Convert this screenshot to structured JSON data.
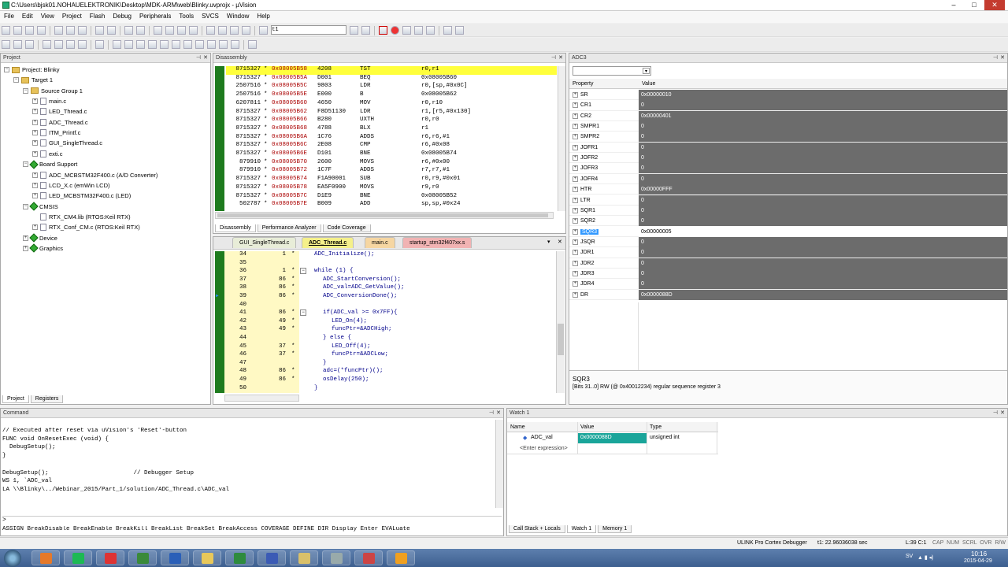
{
  "window": {
    "title": "C:\\Users\\bjsk01.NOHAUELEKTRONIK\\Desktop\\MDK-ARM\\web\\Blinky.uvprojx - µVision",
    "min": "–",
    "max": "□",
    "close": "✕"
  },
  "menu": [
    "File",
    "Edit",
    "View",
    "Project",
    "Flash",
    "Debug",
    "Peripherals",
    "Tools",
    "SVCS",
    "Window",
    "Help"
  ],
  "toolbar": {
    "target_value": "t1"
  },
  "project": {
    "title": "Project",
    "items": [
      {
        "label": "Project: Blinky",
        "indent": 0,
        "exp": "−",
        "icon": "project-icon"
      },
      {
        "label": "Target 1",
        "indent": 1,
        "exp": "−",
        "icon": "folder-icon"
      },
      {
        "label": "Source Group 1",
        "indent": 2,
        "exp": "−",
        "icon": "folder-icon"
      },
      {
        "label": "main.c",
        "indent": 3,
        "exp": "+",
        "icon": "file-icon"
      },
      {
        "label": "LED_Thread.c",
        "indent": 3,
        "exp": "+",
        "icon": "file-icon"
      },
      {
        "label": "ADC_Thread.c",
        "indent": 3,
        "exp": "+",
        "icon": "file-icon"
      },
      {
        "label": "ITM_Printf.c",
        "indent": 3,
        "exp": "+",
        "icon": "file-icon"
      },
      {
        "label": "GUI_SingleThread.c",
        "indent": 3,
        "exp": "+",
        "icon": "file-icon"
      },
      {
        "label": "exti.c",
        "indent": 3,
        "exp": "+",
        "icon": "file-icon"
      },
      {
        "label": "Board Support",
        "indent": 2,
        "exp": "−",
        "icon": "gem-icon"
      },
      {
        "label": "ADC_MCBSTM32F400.c (A/D Converter)",
        "indent": 3,
        "exp": "+",
        "icon": "file-icon"
      },
      {
        "label": "LCD_X.c (emWin LCD)",
        "indent": 3,
        "exp": "+",
        "icon": "file-icon"
      },
      {
        "label": "LED_MCBSTM32F400.c (LED)",
        "indent": 3,
        "exp": "+",
        "icon": "file-icon"
      },
      {
        "label": "CMSIS",
        "indent": 2,
        "exp": "−",
        "icon": "gem-icon"
      },
      {
        "label": "RTX_CM4.lib (RTOS:Keil RTX)",
        "indent": 3,
        "exp": "",
        "icon": "file-icon"
      },
      {
        "label": "RTX_Conf_CM.c (RTOS:Keil RTX)",
        "indent": 3,
        "exp": "+",
        "icon": "file-icon"
      },
      {
        "label": "Device",
        "indent": 2,
        "exp": "+",
        "icon": "gem-icon"
      },
      {
        "label": "Graphics",
        "indent": 2,
        "exp": "+",
        "icon": "gem-icon"
      }
    ],
    "tabs": [
      "Project",
      "Registers"
    ]
  },
  "disassembly": {
    "title": "Disassembly",
    "rows": [
      {
        "count": "8715327",
        "mark": "*",
        "addr": "0x08005B58",
        "op": "4208",
        "mn": "TST",
        "args": "r0,r1",
        "cur": true
      },
      {
        "count": "8715327",
        "mark": "*",
        "addr": "0x08005B5A",
        "op": "D001",
        "mn": "BEQ",
        "args": "0x08005B60"
      },
      {
        "count": "2507516",
        "mark": "*",
        "addr": "0x08005B5C",
        "op": "9803",
        "mn": "LDR",
        "args": "r0,[sp,#0x0C]"
      },
      {
        "count": "2507516",
        "mark": "*",
        "addr": "0x08005B5E",
        "op": "E000",
        "mn": "B",
        "args": "0x08005B62"
      },
      {
        "count": "6207811",
        "mark": "*",
        "addr": "0x08005B60",
        "op": "4650",
        "mn": "MOV",
        "args": "r0,r10"
      },
      {
        "count": "8715327",
        "mark": "*",
        "addr": "0x08005B62",
        "op": "F8D51130",
        "mn": "LDR",
        "args": "r1,[r5,#0x130]"
      },
      {
        "count": "8715327",
        "mark": "*",
        "addr": "0x08005B66",
        "op": "B280",
        "mn": "UXTH",
        "args": "r0,r0"
      },
      {
        "count": "8715327",
        "mark": "*",
        "addr": "0x08005B68",
        "op": "4788",
        "mn": "BLX",
        "args": "r1"
      },
      {
        "count": "8715327",
        "mark": "*",
        "addr": "0x08005B6A",
        "op": "1C76",
        "mn": "ADDS",
        "args": "r6,r6,#1"
      },
      {
        "count": "8715327",
        "mark": "*",
        "addr": "0x08005B6C",
        "op": "2E08",
        "mn": "CMP",
        "args": "r6,#0x08"
      },
      {
        "count": "8715327",
        "mark": "*",
        "addr": "0x08005B6E",
        "op": "D101",
        "mn": "BNE",
        "args": "0x08005B74"
      },
      {
        "count": "879910",
        "mark": "*",
        "addr": "0x08005B70",
        "op": "2600",
        "mn": "MOVS",
        "args": "r6,#0x00"
      },
      {
        "count": "879910",
        "mark": "*",
        "addr": "0x08005B72",
        "op": "1C7F",
        "mn": "ADDS",
        "args": "r7,r7,#1"
      },
      {
        "count": "8715327",
        "mark": "*",
        "addr": "0x08005B74",
        "op": "F1A90001",
        "mn": "SUB",
        "args": "r0,r9,#0x01"
      },
      {
        "count": "8715327",
        "mark": "*",
        "addr": "0x08005B78",
        "op": "EA5F0900",
        "mn": "MOVS",
        "args": "r9,r0"
      },
      {
        "count": "8715327",
        "mark": "*",
        "addr": "0x08005B7C",
        "op": "D1E9",
        "mn": "BNE",
        "args": "0x08005B52"
      },
      {
        "count": "502787",
        "mark": "*",
        "addr": "0x08005B7E",
        "op": "B009",
        "mn": "ADD",
        "args": "sp,sp,#0x24"
      }
    ],
    "tabs": [
      "Disassembly",
      "Performance Analyzer",
      "Code Coverage"
    ]
  },
  "editor": {
    "tabs": [
      "GUI_SingleThread.c",
      "ADC_Thread.c",
      "main.c",
      "startup_stm32f407xx.s"
    ],
    "lines": [
      {
        "n": "34",
        "c": "1",
        "s": "*",
        "fold": "",
        "t": "ADC_Initialize();",
        "ind": 0
      },
      {
        "n": "35",
        "c": "",
        "s": "",
        "fold": "",
        "t": "",
        "ind": 0
      },
      {
        "n": "36",
        "c": "1",
        "s": "*",
        "fold": "−",
        "t": "while (1) {",
        "ind": 0
      },
      {
        "n": "37",
        "c": "86",
        "s": "*",
        "fold": "",
        "t": "ADC_StartConversion();",
        "ind": 1
      },
      {
        "n": "38",
        "c": "86",
        "s": "*",
        "fold": "",
        "t": "ADC_val=ADC_GetValue();",
        "ind": 1
      },
      {
        "n": "39",
        "c": "86",
        "s": "*",
        "fold": "",
        "t": "ADC_ConversionDone();",
        "ind": 1,
        "arrow": true
      },
      {
        "n": "40",
        "c": "",
        "s": "",
        "fold": "",
        "t": "",
        "ind": 0
      },
      {
        "n": "41",
        "c": "86",
        "s": "*",
        "fold": "−",
        "t": "if(ADC_val >= 0x7FF){",
        "ind": 1
      },
      {
        "n": "42",
        "c": "49",
        "s": "*",
        "fold": "",
        "t": "LED_On(4);",
        "ind": 2
      },
      {
        "n": "43",
        "c": "49",
        "s": "*",
        "fold": "",
        "t": "funcPtr=&ADCHigh;",
        "ind": 2
      },
      {
        "n": "44",
        "c": "",
        "s": "",
        "fold": "",
        "t": "} else {",
        "ind": 1
      },
      {
        "n": "45",
        "c": "37",
        "s": "*",
        "fold": "",
        "t": "LED_Off(4);",
        "ind": 2
      },
      {
        "n": "46",
        "c": "37",
        "s": "*",
        "fold": "",
        "t": "funcPtr=&ADCLow;",
        "ind": 2
      },
      {
        "n": "47",
        "c": "",
        "s": "",
        "fold": "",
        "t": "}",
        "ind": 1
      },
      {
        "n": "48",
        "c": "86",
        "s": "*",
        "fold": "",
        "t": "adc=(*funcPtr)();",
        "ind": 1
      },
      {
        "n": "49",
        "c": "86",
        "s": "*",
        "fold": "",
        "t": "osDelay(250);",
        "ind": 1
      },
      {
        "n": "50",
        "c": "",
        "s": "",
        "fold": "",
        "t": "}",
        "ind": 0
      }
    ]
  },
  "adc": {
    "title": "ADC3",
    "col_property": "Property",
    "col_value": "Value",
    "regs": [
      {
        "n": "SR",
        "v": "0x00000010"
      },
      {
        "n": "CR1",
        "v": "0"
      },
      {
        "n": "CR2",
        "v": "0x00000401"
      },
      {
        "n": "SMPR1",
        "v": "0"
      },
      {
        "n": "SMPR2",
        "v": "0"
      },
      {
        "n": "JOFR1",
        "v": "0"
      },
      {
        "n": "JOFR2",
        "v": "0"
      },
      {
        "n": "JOFR3",
        "v": "0"
      },
      {
        "n": "JOFR4",
        "v": "0"
      },
      {
        "n": "HTR",
        "v": "0x00000FFF"
      },
      {
        "n": "LTR",
        "v": "0"
      },
      {
        "n": "SQR1",
        "v": "0"
      },
      {
        "n": "SQR2",
        "v": "0"
      },
      {
        "n": "SQR3",
        "v": "0x00000005",
        "sel": true
      },
      {
        "n": "JSQR",
        "v": "0"
      },
      {
        "n": "JDR1",
        "v": "0"
      },
      {
        "n": "JDR2",
        "v": "0"
      },
      {
        "n": "JDR3",
        "v": "0"
      },
      {
        "n": "JDR4",
        "v": "0"
      },
      {
        "n": "DR",
        "v": "0x0000088D"
      }
    ],
    "desc_title": "SQR3",
    "desc_text": "[Bits 31..0] RW (@ 0x40012234) regular sequence register 3"
  },
  "command": {
    "title": "Command",
    "lines": [
      "// Executed after reset via uVision's 'Reset'-button",
      "FUNC void OnResetExec (void) {",
      "  DebugSetup();",
      "}",
      "",
      "DebugSetup();                        // Debugger Setup",
      "WS 1, `ADC_val",
      "LA \\\\Blinky\\../Webinar_2015/Part_1/solution/ADC_Thread.c\\ADC_val"
    ],
    "prompt": ">",
    "hint": "ASSIGN BreakDisable BreakEnable BreakKill BreakList BreakSet BreakAccess COVERAGE DEFINE DIR Display Enter EVALuate"
  },
  "watch": {
    "title": "Watch 1",
    "cols": [
      "Name",
      "Value",
      "Type"
    ],
    "row_name": "ADC_val",
    "row_value": "0x0000088D",
    "row_type": "unsigned int",
    "enter": "<Enter expression>",
    "tabs": [
      "Call Stack + Locals",
      "Watch 1",
      "Memory 1"
    ]
  },
  "status": {
    "debugger": "ULINK Pro Cortex Debugger",
    "time": "t1: 22.96036038 sec",
    "pos": "L:39 C:1",
    "flags": "CAP  NUM  SCRL  OVR  R/W"
  },
  "taskbar": {
    "lang": "SV",
    "time": "10:16",
    "date": "2015-04-29",
    "buttons": [
      "#e5792a",
      "#1db954",
      "#d33",
      "#3a8a3a",
      "#2a5fb8",
      "#e8c85a",
      "#2e8b3e",
      "#3b5bb5",
      "#d9c06a",
      "#9aa",
      "#c44",
      "#f0a020"
    ]
  }
}
